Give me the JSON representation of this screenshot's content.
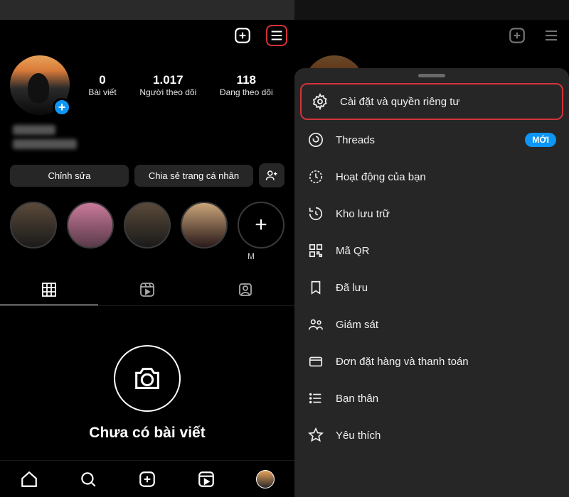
{
  "stats": {
    "posts": {
      "num": "0",
      "label": "Bài viết"
    },
    "followers": {
      "num": "1.017",
      "label": "Người theo dõi"
    },
    "following": {
      "num": "118",
      "label": "Đang theo dõi"
    },
    "following_r": "Đang theo dõ"
  },
  "actions": {
    "edit": "Chỉnh sửa",
    "share": "Chia sẻ trang cá nhân"
  },
  "highlights": {
    "add_label": "M"
  },
  "empty": {
    "text": "Chưa có bài viết"
  },
  "menu": {
    "settings": "Cài đặt và quyền riêng tư",
    "threads": "Threads",
    "threads_badge": "MỚI",
    "activity": "Hoạt động của bạn",
    "archive": "Kho lưu trữ",
    "qr": "Mã QR",
    "saved": "Đã lưu",
    "supervision": "Giám sát",
    "orders": "Đơn đặt hàng và thanh toán",
    "close_friends": "Bạn thân",
    "favorites": "Yêu thích"
  }
}
